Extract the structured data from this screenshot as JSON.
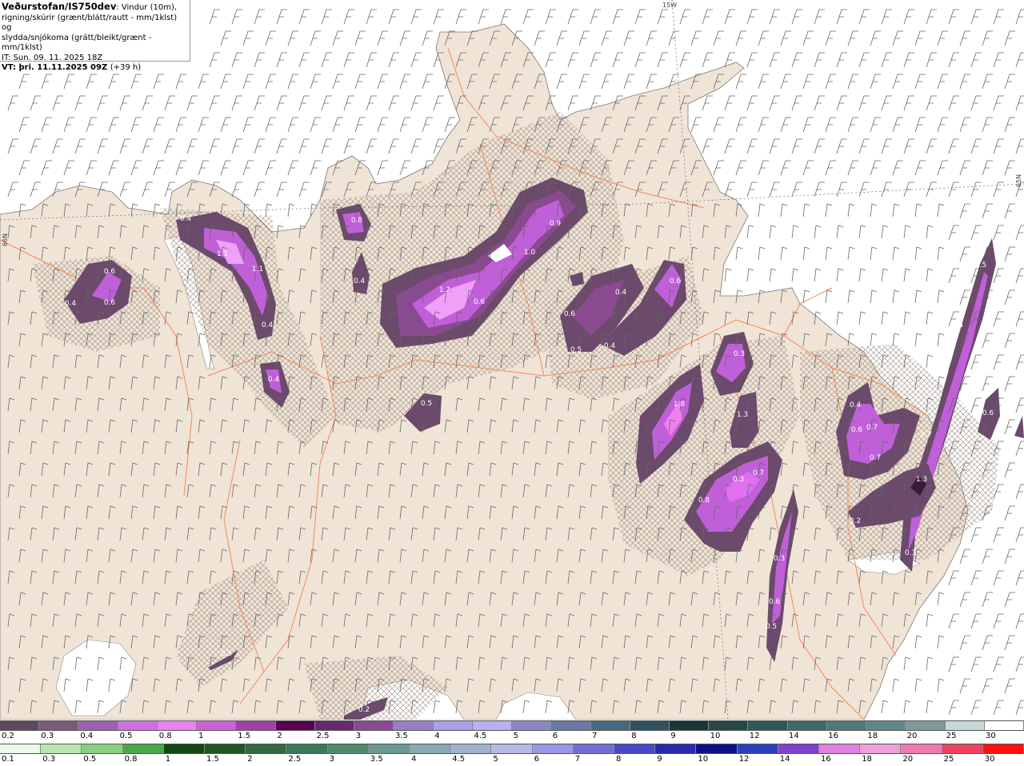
{
  "header": {
    "agency_model": "Veðurstofan/IS750dev",
    "desc_line1": ": Vindur (10m),",
    "desc_line2": "rigning/skúrir (grænt/blátt/rautt - mm/1klst) og",
    "desc_line3": "slydda/snjókoma (grátt/bleikt/grænt - mm/1klst)",
    "it_line": "IT: Sun. 09. 11. 2025 18Z",
    "vt_label": "VT: þri. 11.11.2025 09Z",
    "vt_offset": "(+39 h)"
  },
  "grid_labels": {
    "lon_top": "15W",
    "lat_left": "66N",
    "lat_right": "65N"
  },
  "map": {
    "land_color": "#f0e4d6",
    "sea_color": "#ffffff",
    "road_color": "#f08a5a",
    "precip_colors": [
      "#6b4a6b",
      "#8a4a8f",
      "#c060d8",
      "#e070f0",
      "#f0a0f8"
    ],
    "value_labels": [
      "0.4",
      "1.1",
      "1.1",
      "0.4",
      "0.8",
      "0.4",
      "0.9",
      "1.0",
      "1.2",
      "0.6",
      "0.6",
      "0.6",
      "0.4",
      "0.6",
      "0.4",
      "0.6",
      "0.5",
      "0.4",
      "0.4",
      "0.5",
      "0.3",
      "1.8",
      "1.3",
      "0.3",
      "0.7",
      "0.8",
      "0.4",
      "0.6",
      "0.7",
      "0.7",
      "0.7",
      "1.3",
      "3.2",
      "0.3",
      "0.5",
      "0.4",
      "0.6",
      "0.3",
      "0.6",
      "0.5",
      "0.5",
      "0.2",
      "0.3"
    ]
  },
  "legend_snow": {
    "ticks": [
      "0.2",
      "0.3",
      "0.4",
      "0.5",
      "0.8",
      "1",
      "1.5",
      "2",
      "2.5",
      "3",
      "3.5",
      "4",
      "4.5",
      "5",
      "6",
      "7",
      "8",
      "9",
      "10",
      "12",
      "14",
      "16",
      "18",
      "20",
      "25",
      "30"
    ],
    "colors": [
      "#5e4a5e",
      "#7a5a7a",
      "#a060b0",
      "#d070e0",
      "#f080f0",
      "#d060d8",
      "#a040a8",
      "#5a0050",
      "#6a2870",
      "#8a4a96",
      "#9880c8",
      "#a8a0e8",
      "#b8b0f0",
      "#8888c8",
      "#6878a8",
      "#486880",
      "#305060",
      "#183838",
      "#284848",
      "#305a5a",
      "#406a6a",
      "#507a7a",
      "#608888",
      "#809898",
      "#c8d8d8",
      "#ffffff"
    ]
  },
  "legend_rain": {
    "ticks": [
      "0.1",
      "0.3",
      "0.5",
      "0.8",
      "1",
      "1.5",
      "2",
      "2.5",
      "3",
      "3.5",
      "4",
      "4.5",
      "5",
      "6",
      "7",
      "8",
      "9",
      "10",
      "12",
      "14",
      "16",
      "18",
      "20",
      "25",
      "30"
    ],
    "colors": [
      "#e8fbe8",
      "#b8e8b0",
      "#88d080",
      "#48a848",
      "#104810",
      "#205820",
      "#306a40",
      "#3a7858",
      "#508870",
      "#6a9a90",
      "#8aa8b0",
      "#a0b0d0",
      "#b8b8e8",
      "#9898e8",
      "#7070d8",
      "#4848c8",
      "#2828b0",
      "#10108a",
      "#2a40c0",
      "#8040d0",
      "#e080e0",
      "#f0a0d8",
      "#f07ab0",
      "#f04060",
      "#ff1010"
    ]
  }
}
